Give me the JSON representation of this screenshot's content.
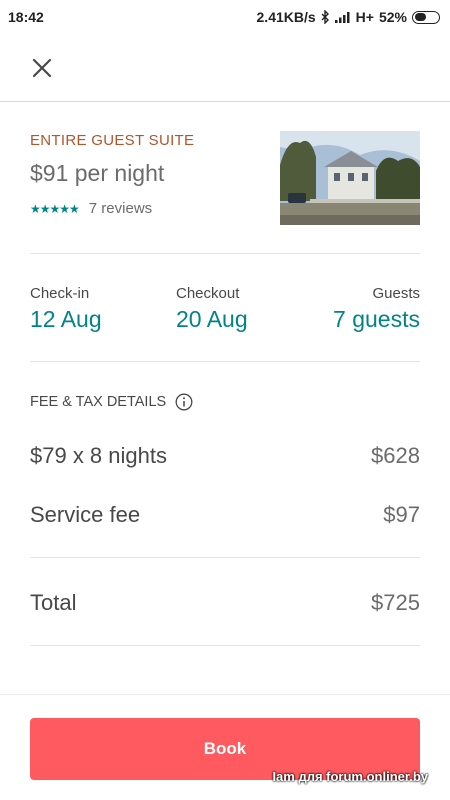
{
  "status_bar": {
    "time": "18:42",
    "network_speed": "2.41KB/s",
    "network_type": "H+",
    "battery": "52%",
    "icons": [
      "bluetooth-icon",
      "signal-icon",
      "battery-icon"
    ]
  },
  "toolbar": {
    "close_icon": "close-icon"
  },
  "listing": {
    "type": "ENTIRE GUEST SUITE",
    "price": "$91 per night",
    "stars": "★★★★★",
    "rating": 4.5,
    "reviews": "7 reviews"
  },
  "trip": {
    "checkin_label": "Check-in",
    "checkin_value": "12 Aug",
    "checkout_label": "Checkout",
    "checkout_value": "20 Aug",
    "guests_label": "Guests",
    "guests_value": "7 guests"
  },
  "fees": {
    "header": "FEE & TAX DETAILS",
    "nights_label": "$79 x 8 nights",
    "nights_amount": "$628",
    "service_label": "Service fee",
    "service_amount": "$97"
  },
  "total": {
    "label": "Total",
    "amount": "$725"
  },
  "footer": {
    "book_label": "Book",
    "watermark": "Iam для forum.onliner.by"
  },
  "colors": {
    "accent": "#008489",
    "brand": "#ff5a5f",
    "type_label": "#b1552a"
  }
}
